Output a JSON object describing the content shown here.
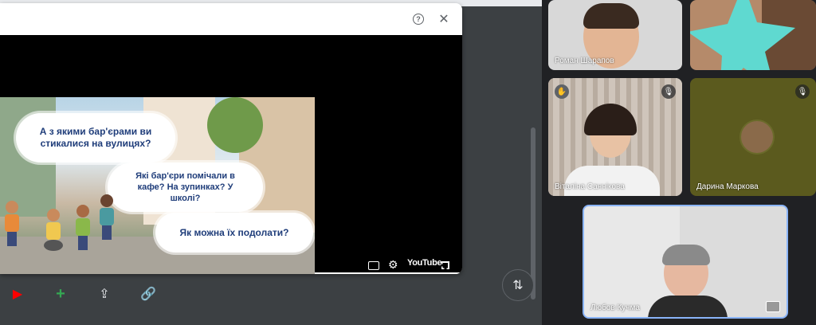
{
  "background_text": "",
  "dialog": {
    "help_icon": "?",
    "close_icon": "✕"
  },
  "slide": {
    "bubble1": "А з якими бар'єрами ви стикалися на вулицях?",
    "bubble2": "Які бар'єри помічали в кафе? На зупинках? У школі?",
    "bubble3": "Як можна їх подолати?"
  },
  "player": {
    "progress_fraction": 0.13,
    "youtube_label": "YouTube"
  },
  "participants": [
    {
      "name": "Роман Шарапов"
    },
    {
      "name": ""
    },
    {
      "name": "Віталіна Саннікова"
    },
    {
      "name": "Дарина Маркова"
    },
    {
      "name": "Любов Кучма"
    }
  ],
  "colors": {
    "accent_blue": "#8ab4f8",
    "youtube_red": "#ff0000",
    "tile_bg": "#3c4043",
    "teal_star": "#5fd9d0"
  }
}
